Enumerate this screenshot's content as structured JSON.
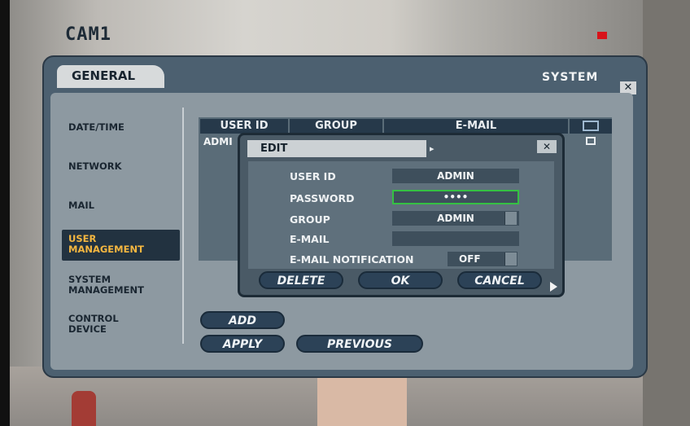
{
  "camera": {
    "label": "CAM1"
  },
  "header": {
    "tab_general": "GENERAL",
    "system": "SYSTEM",
    "close": "✕"
  },
  "sidebar": {
    "items": [
      {
        "label": "DATE/TIME"
      },
      {
        "label": "NETWORK"
      },
      {
        "label": "MAIL"
      },
      {
        "label": "USER MANAGEMENT"
      },
      {
        "label": "SYSTEM MANAGEMENT"
      },
      {
        "label": "CONTROL DEVICE"
      }
    ]
  },
  "table": {
    "columns": [
      "USER ID",
      "GROUP",
      "E-MAIL"
    ],
    "rows": [
      {
        "user_id": "ADMI"
      }
    ]
  },
  "dialog": {
    "title": "EDIT",
    "title_arrow": "▸",
    "close": "✕",
    "fields": {
      "user_id": {
        "label": "USER ID",
        "value": "ADMIN"
      },
      "password": {
        "label": "PASSWORD",
        "value": "••••"
      },
      "group": {
        "label": "GROUP",
        "value": "ADMIN"
      },
      "email": {
        "label": "E-MAIL",
        "value": ""
      },
      "email_notification": {
        "label": "E-MAIL NOTIFICATION",
        "value": "OFF"
      }
    },
    "buttons": {
      "delete": "DELETE",
      "ok": "OK",
      "cancel": "CANCEL"
    }
  },
  "actions": {
    "add": "ADD",
    "apply": "APPLY",
    "previous": "PREVIOUS"
  },
  "colors": {
    "panel": "#4c6070",
    "active_item": "#f4b640",
    "record": "#d8131a"
  }
}
